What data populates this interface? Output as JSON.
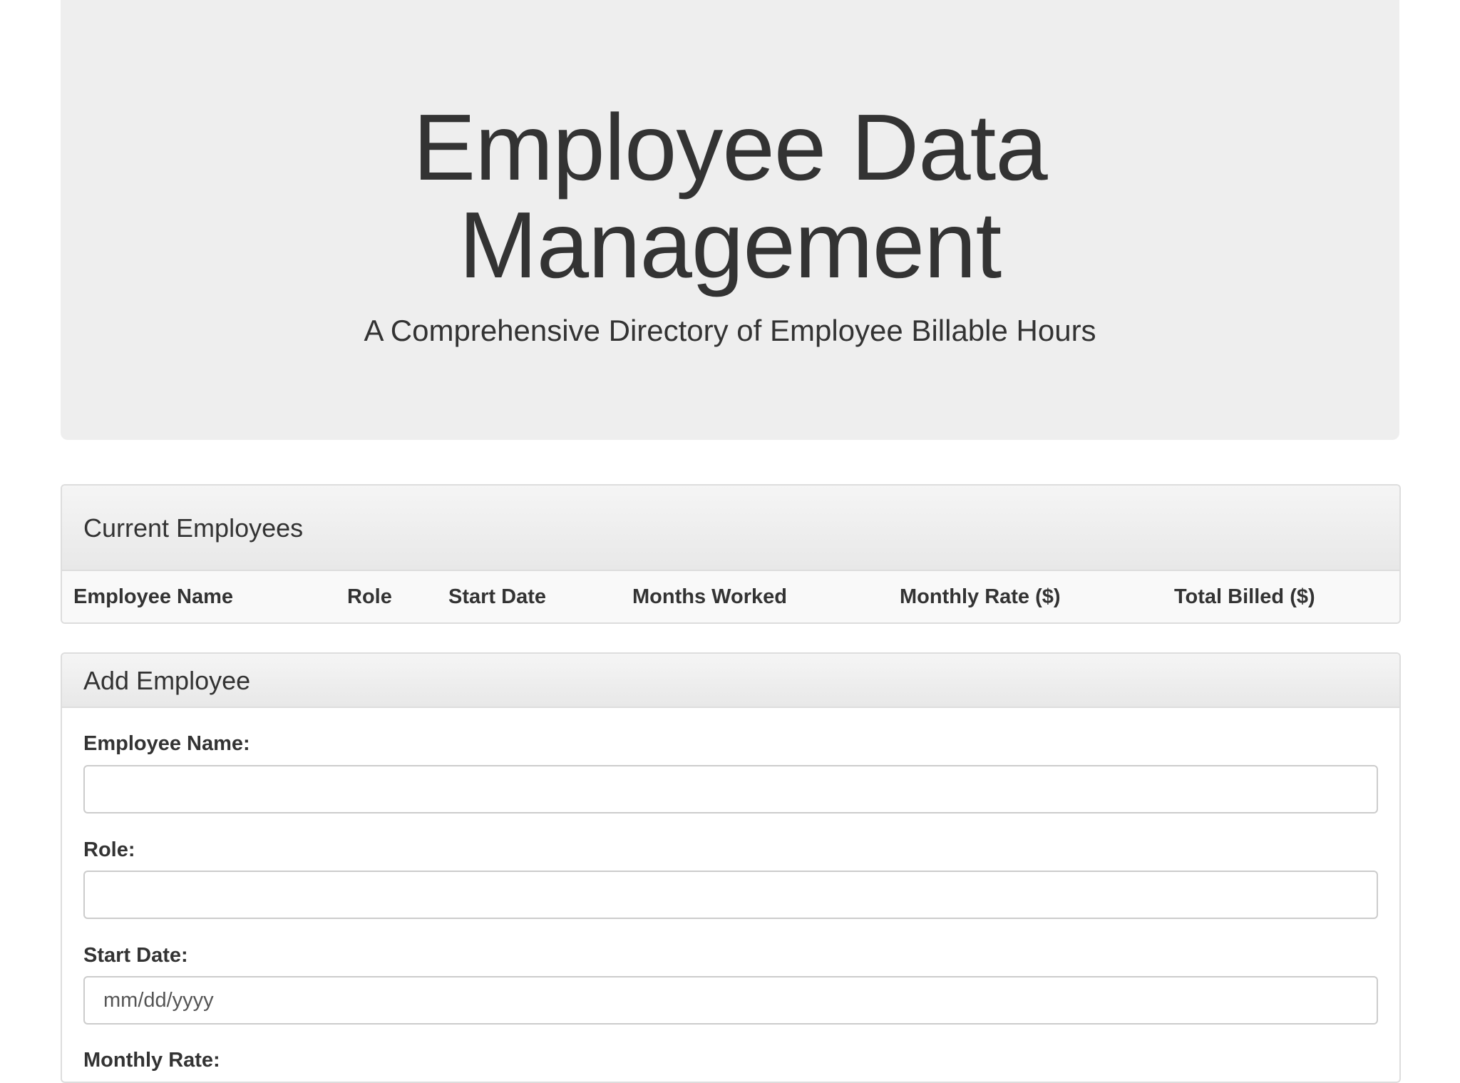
{
  "header": {
    "title": "Employee Data Management",
    "subtitle": "A Comprehensive Directory of Employee Billable Hours"
  },
  "employees_panel": {
    "title": "Current Employees",
    "columns": [
      "Employee Name",
      "Role",
      "Start Date",
      "Months Worked",
      "Monthly Rate ($)",
      "Total Billed ($)"
    ]
  },
  "add_panel": {
    "title": "Add Employee",
    "fields": [
      {
        "label": "Employee Name:",
        "value": "",
        "placeholder": ""
      },
      {
        "label": "Role:",
        "value": "",
        "placeholder": ""
      },
      {
        "label": "Start Date:",
        "value": "",
        "placeholder": "mm/dd/yyyy"
      },
      {
        "label": "Monthly Rate:",
        "value": "",
        "placeholder": ""
      }
    ]
  }
}
